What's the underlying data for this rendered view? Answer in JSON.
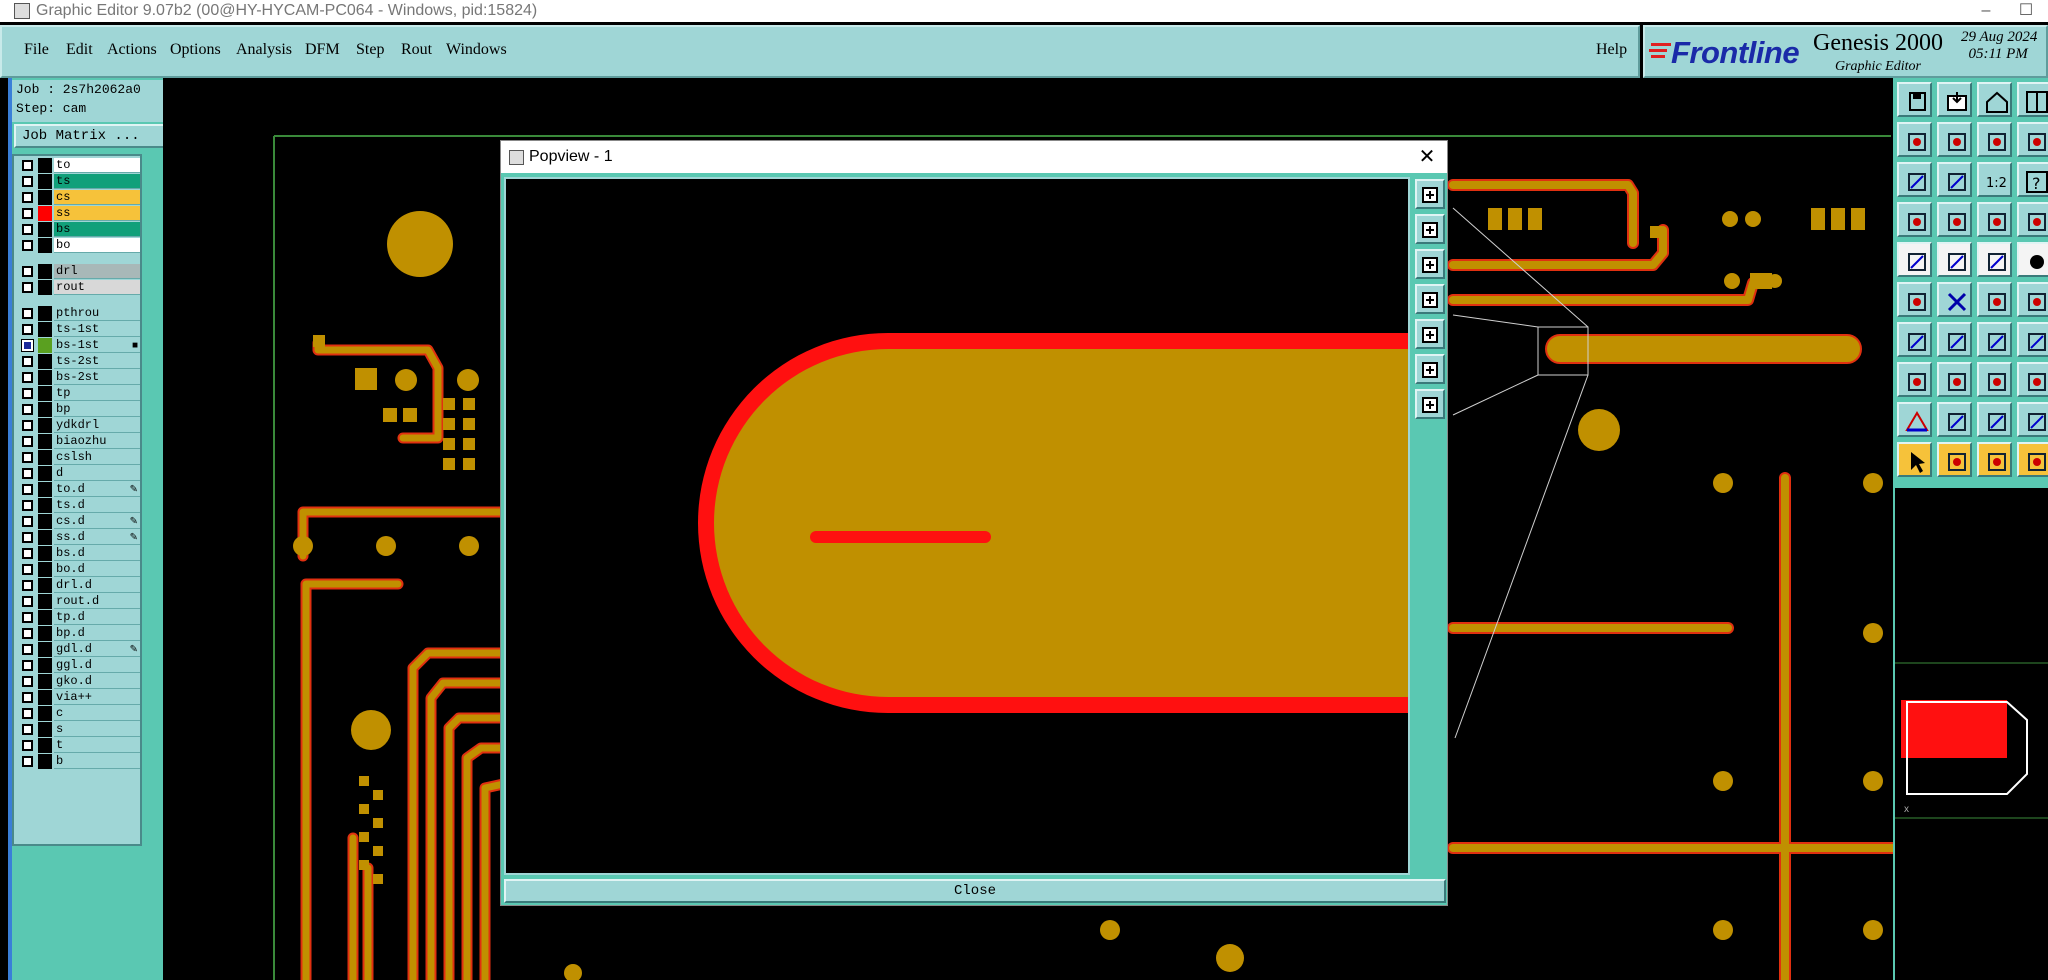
{
  "window": {
    "title": "Graphic Editor 9.07b2 (00@HY-HYCAM-PC064 - Windows, pid:15824)"
  },
  "menu": {
    "items": [
      "File",
      "Edit",
      "Actions",
      "Options",
      "Analysis",
      "DFM",
      "Step",
      "Rout",
      "Windows"
    ],
    "help": "Help"
  },
  "brand": {
    "logo": "Frontline",
    "product": "Genesis 2000",
    "subtitle": "Graphic Editor",
    "date": "29 Aug 2024",
    "time": "05:11 PM"
  },
  "job": {
    "job_label": "Job : 2s7h2062a0",
    "step_label": "Step: cam",
    "matrix_button": "Job Matrix ..."
  },
  "layers": [
    {
      "name": "to",
      "color": "#ffffff",
      "swatch": "#000000"
    },
    {
      "name": "ts",
      "color": "#11a07a",
      "swatch": "#000000"
    },
    {
      "name": "cs",
      "color": "#f6c23a",
      "swatch": "#000000"
    },
    {
      "name": "ss",
      "color": "#f6c23a",
      "swatch": "#ff0000"
    },
    {
      "name": "bs",
      "color": "#11a07a",
      "swatch": "#000000"
    },
    {
      "name": "bo",
      "color": "#ffffff",
      "swatch": "#000000"
    },
    {
      "name": "drl",
      "color": "#a8b8b8",
      "swatch": "#000000"
    },
    {
      "name": "rout",
      "color": "#d8d8d8",
      "swatch": "#000000"
    },
    {
      "name": "pthrou",
      "color": "#9fd6d6",
      "swatch": "#000000"
    },
    {
      "name": "ts-1st",
      "color": "#9fd6d6",
      "swatch": "#000000"
    },
    {
      "name": "bs-1st",
      "color": "#9fd6d6",
      "swatch": "#5aa020",
      "on": true,
      "mark": "■"
    },
    {
      "name": "ts-2st",
      "color": "#9fd6d6",
      "swatch": "#000000"
    },
    {
      "name": "bs-2st",
      "color": "#9fd6d6",
      "swatch": "#000000"
    },
    {
      "name": "tp",
      "color": "#9fd6d6",
      "swatch": "#000000"
    },
    {
      "name": "bp",
      "color": "#9fd6d6",
      "swatch": "#000000"
    },
    {
      "name": "ydkdrl",
      "color": "#9fd6d6",
      "swatch": "#000000"
    },
    {
      "name": "biaozhu",
      "color": "#9fd6d6",
      "swatch": "#000000"
    },
    {
      "name": "cslsh",
      "color": "#9fd6d6",
      "swatch": "#000000"
    },
    {
      "name": "d",
      "color": "#9fd6d6",
      "swatch": "#000000"
    },
    {
      "name": "to.d",
      "color": "#9fd6d6",
      "swatch": "#000000",
      "mark": "✎"
    },
    {
      "name": "ts.d",
      "color": "#9fd6d6",
      "swatch": "#000000"
    },
    {
      "name": "cs.d",
      "color": "#9fd6d6",
      "swatch": "#000000",
      "mark": "✎"
    },
    {
      "name": "ss.d",
      "color": "#9fd6d6",
      "swatch": "#000000",
      "mark": "✎"
    },
    {
      "name": "bs.d",
      "color": "#9fd6d6",
      "swatch": "#000000"
    },
    {
      "name": "bo.d",
      "color": "#9fd6d6",
      "swatch": "#000000"
    },
    {
      "name": "drl.d",
      "color": "#9fd6d6",
      "swatch": "#000000"
    },
    {
      "name": "rout.d",
      "color": "#9fd6d6",
      "swatch": "#000000"
    },
    {
      "name": "tp.d",
      "color": "#9fd6d6",
      "swatch": "#000000"
    },
    {
      "name": "bp.d",
      "color": "#9fd6d6",
      "swatch": "#000000"
    },
    {
      "name": "gdl.d",
      "color": "#9fd6d6",
      "swatch": "#000000",
      "mark": "✎"
    },
    {
      "name": "ggl.d",
      "color": "#9fd6d6",
      "swatch": "#000000"
    },
    {
      "name": "gko.d",
      "color": "#9fd6d6",
      "swatch": "#000000"
    },
    {
      "name": "via++",
      "color": "#9fd6d6",
      "swatch": "#000000"
    },
    {
      "name": "c",
      "color": "#9fd6d6",
      "swatch": "#000000"
    },
    {
      "name": "s",
      "color": "#9fd6d6",
      "swatch": "#000000"
    },
    {
      "name": "t",
      "color": "#9fd6d6",
      "swatch": "#000000"
    },
    {
      "name": "b",
      "color": "#9fd6d6",
      "swatch": "#000000"
    }
  ],
  "popview": {
    "title": "Popview - 1",
    "close_label": "Close"
  },
  "colors": {
    "copper": "#c09000",
    "mask_red": "#ff1010",
    "outline_green": "#3a8a3a",
    "panel": "#9fd6d6",
    "panel_dark": "#5ac8b2"
  },
  "tools": [
    "save-icon",
    "open-icon",
    "home-icon",
    "frame-icon",
    "zoom-in-icon",
    "zoom-out-icon",
    "swap-icon",
    "snap-icon",
    "pan-icon",
    "fit-icon",
    "ratio-icon",
    "help-icon",
    "measure-icon",
    "connect-icon",
    "layer-icon",
    "grid-icon",
    "pad-icon",
    "shape-icon",
    "line-icon",
    "circle-icon",
    "net-icon",
    "cross-icon",
    "node-icon",
    "arc-icon",
    "draw-line-icon",
    "diagonal-icon",
    "rotate-icon",
    "flip-icon",
    "select-box-icon",
    "trim-icon",
    "align-icon",
    "group-icon",
    "triangle-icon",
    "fill-tri-icon",
    "outline-tri-icon",
    "edit-tri-icon",
    "pointer-icon",
    "pointer-box-icon",
    "pointer-circle-icon",
    "pointer-net-icon"
  ]
}
